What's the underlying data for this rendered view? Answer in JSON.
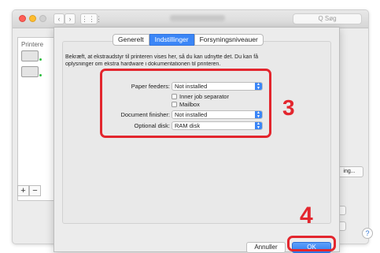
{
  "window": {
    "search_placeholder": "Q Søg",
    "sidebar_label": "Printere",
    "add_label": "+",
    "remove_label": "−",
    "options_button_fragment": "ing...",
    "help_label": "?"
  },
  "sheet": {
    "tabs": [
      {
        "label": "Generelt",
        "active": false
      },
      {
        "label": "Indstillinger",
        "active": true
      },
      {
        "label": "Forsyningsniveauer",
        "active": false
      }
    ],
    "description_line1": "Bekræft, at ekstraudstyr til printeren vises her, så du kan udnytte det. Du kan få",
    "description_line2": "oplysninger om ekstra hardware i dokumentationen til printeren.",
    "options": {
      "paper_feeders": {
        "label": "Paper feeders:",
        "value": "Not installed"
      },
      "inner_job_separator": {
        "label": "Inner job separator",
        "checked": false
      },
      "mailbox": {
        "label": "Mailbox",
        "checked": false
      },
      "document_finisher": {
        "label": "Document finisher:",
        "value": "Not installed"
      },
      "optional_disk": {
        "label": "Optional disk:",
        "value": "RAM disk"
      }
    },
    "cancel_label": "Annuller",
    "ok_label": "OK"
  },
  "annotations": {
    "step_options": "3",
    "step_ok": "4",
    "color": "#e3262e"
  },
  "colors": {
    "accent": "#3b86f7"
  }
}
